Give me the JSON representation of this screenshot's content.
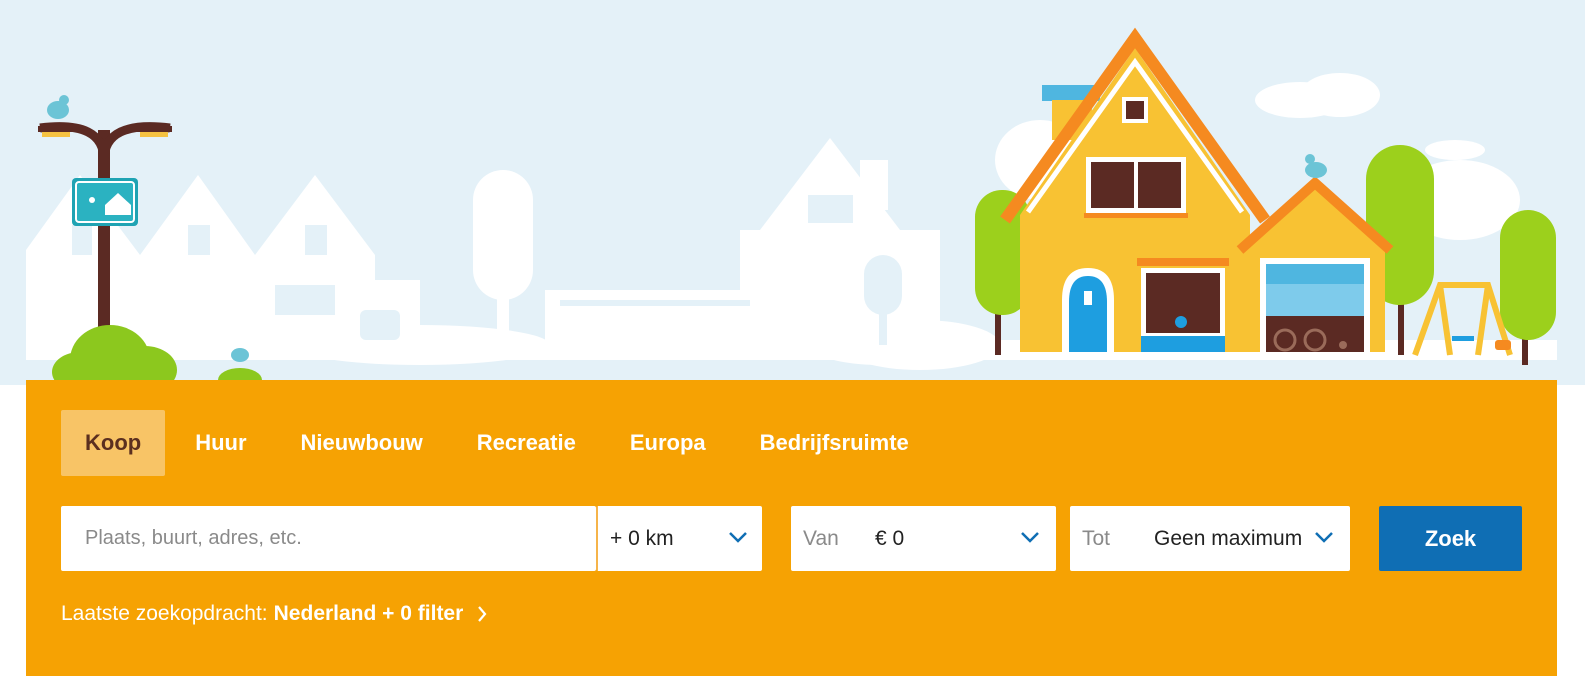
{
  "tabs": [
    {
      "label": "Koop",
      "active": true
    },
    {
      "label": "Huur",
      "active": false
    },
    {
      "label": "Nieuwbouw",
      "active": false
    },
    {
      "label": "Recreatie",
      "active": false
    },
    {
      "label": "Europa",
      "active": false
    },
    {
      "label": "Bedrijfsruimte",
      "active": false
    }
  ],
  "search": {
    "placeholder": "Plaats, buurt, adres, etc.",
    "value": ""
  },
  "radius": {
    "value": "+ 0 km",
    "icon": "chevron-down-icon"
  },
  "price_from": {
    "label": "Van",
    "value": "€ 0",
    "icon": "chevron-down-icon"
  },
  "price_to": {
    "label": "Tot",
    "value": "Geen maximum",
    "icon": "chevron-down-icon"
  },
  "submit": {
    "label": "Zoek"
  },
  "last_search": {
    "prefix": "Laatste zoekopdracht:",
    "value": "Nederland + 0 filter",
    "icon": "chevron-right-icon"
  },
  "colors": {
    "panel": "#f6a203",
    "active_tab_bg": "#f8c466",
    "active_tab_text": "#5b2f1f",
    "button": "#0f6eb4",
    "sky": "#e4f1f8"
  }
}
